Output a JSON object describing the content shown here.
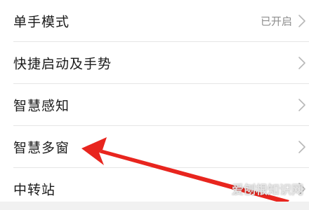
{
  "settings": {
    "items": [
      {
        "label": "单手模式",
        "status": "已开启"
      },
      {
        "label": "快捷启动及手势"
      },
      {
        "label": "智慧感知"
      },
      {
        "label": "智慧多窗"
      },
      {
        "label": "中转站"
      }
    ]
  },
  "annotation": {
    "arrow_color": "#e8251e",
    "points_to": "智慧多窗"
  },
  "watermark": {
    "text": "爱刨根知识网"
  },
  "colors": {
    "background": "#f1f1f1",
    "card": "#ffffff",
    "text_primary": "#1a1a1a",
    "text_secondary": "#8e8e8e",
    "divider": "#e6e6e6"
  }
}
